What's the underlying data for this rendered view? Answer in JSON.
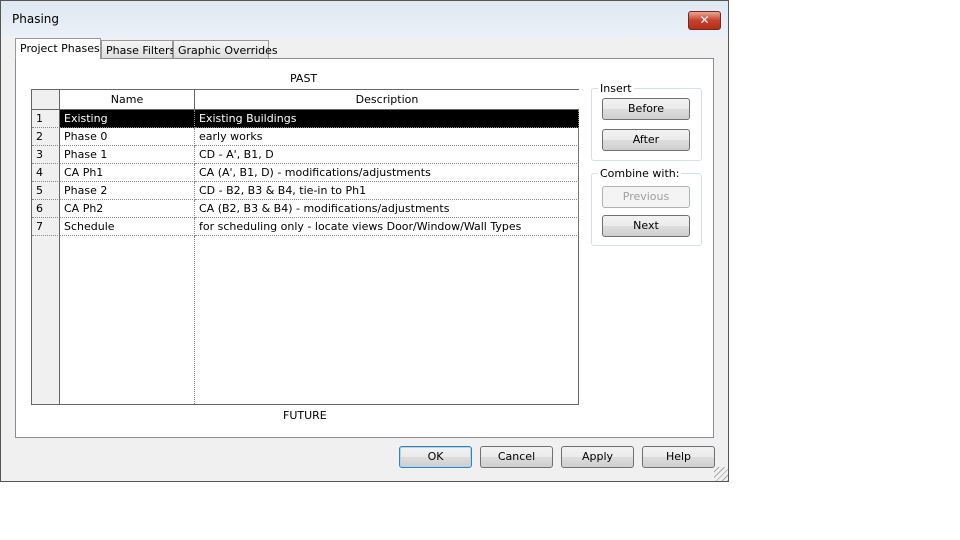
{
  "window": {
    "title": "Phasing",
    "close_icon": "close-icon"
  },
  "tabs": [
    {
      "label": "Project Phases",
      "active": true
    },
    {
      "label": "Phase Filters"
    },
    {
      "label": "Graphic Overrides"
    }
  ],
  "labels": {
    "past": "PAST",
    "future": "FUTURE"
  },
  "table": {
    "columns": [
      "Name",
      "Description"
    ],
    "rows": [
      {
        "num": "1",
        "name": "Existing",
        "description": "Existing Buildings",
        "selected": true
      },
      {
        "num": "2",
        "name": "Phase 0",
        "description": "early works"
      },
      {
        "num": "3",
        "name": "Phase 1",
        "description": "CD - A', B1, D"
      },
      {
        "num": "4",
        "name": "CA Ph1",
        "description": "CA (A', B1, D) - modifications/adjustments"
      },
      {
        "num": "5",
        "name": "Phase 2",
        "description": "CD - B2, B3 & B4, tie-in to Ph1"
      },
      {
        "num": "6",
        "name": "CA Ph2",
        "description": "CA (B2, B3 & B4) - modifications/adjustments"
      },
      {
        "num": "7",
        "name": "Schedule",
        "description": "for scheduling only - locate views Door/Window/Wall Types"
      }
    ]
  },
  "insert": {
    "label": "Insert",
    "before": "Before",
    "after": "After"
  },
  "combine": {
    "label": "Combine with:",
    "previous": "Previous",
    "next": "Next"
  },
  "footer": {
    "ok": "OK",
    "cancel": "Cancel",
    "apply": "Apply",
    "help": "Help"
  }
}
